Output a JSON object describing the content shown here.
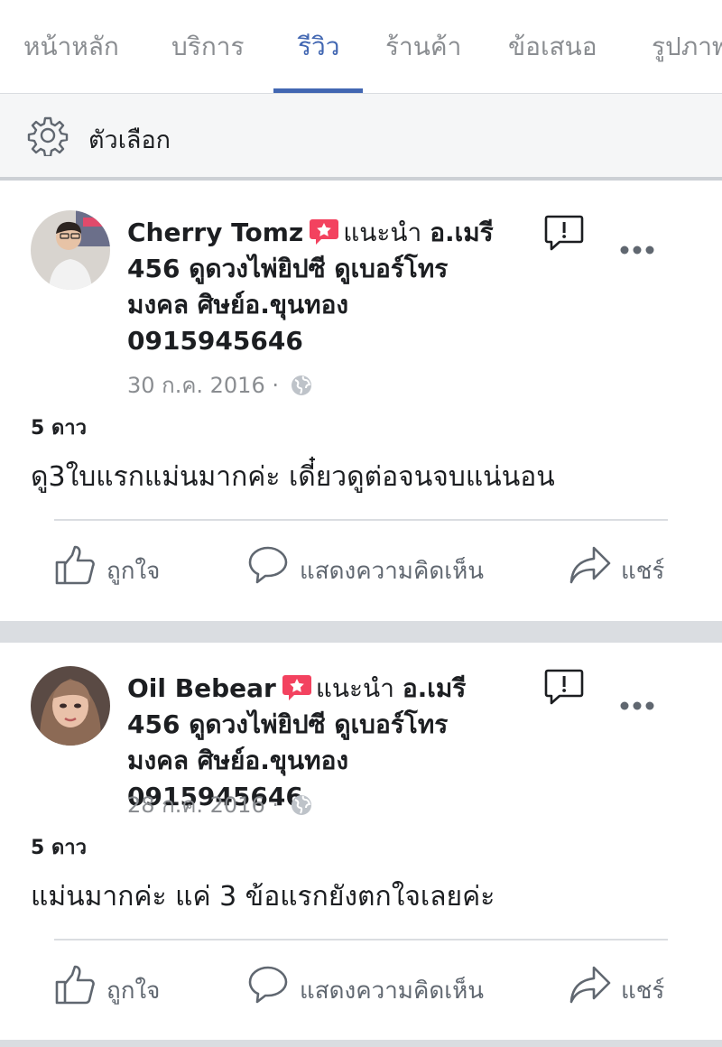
{
  "tabs": [
    {
      "label": "หน้าหลัก",
      "active": false
    },
    {
      "label": "บริการ",
      "active": false
    },
    {
      "label": "รีวิว",
      "active": true
    },
    {
      "label": "ร้านค้า",
      "active": false
    },
    {
      "label": "ข้อเสนอ",
      "active": false
    },
    {
      "label": "รูปภาพ",
      "active": false
    }
  ],
  "options": {
    "label": "ตัวเลือก",
    "icon": "gear-icon"
  },
  "colors": {
    "accent": "#4267b2",
    "recommend": "#f3425f",
    "muted": "#8a8d91"
  },
  "reviews": [
    {
      "author": "Cherry Tomz",
      "recommends_text": "แนะนำ",
      "page_name": "อ.เมรี 456 ดูดวงไพ่ยิปซี ดูเบอร์โทรมงคล ศิษย์อ.ขุนทอง 0915945646",
      "date": "30 ก.ค. 2016 ·",
      "rating": "5 ดาว",
      "text": "ดู3ใบแรกแม่นมากค่ะ เดี๋ยวดูต่อจนจบแน่นอน"
    },
    {
      "author": "Oil Bebear",
      "recommends_text": "แนะนำ",
      "page_name": "อ.เมรี 456 ดูดวงไพ่ยิปซี ดูเบอร์โทรมงคล ศิษย์อ.ขุนทอง 0915945646",
      "date": "28 ก.ค. 2016 ·",
      "rating": "5 ดาว",
      "text": "แม่นมากค่ะ แค่ 3 ข้อแรกยังตกใจเลยค่ะ"
    }
  ],
  "actions": {
    "like": "ถูกใจ",
    "comment": "แสดงความคิดเห็น",
    "share": "แชร์"
  }
}
